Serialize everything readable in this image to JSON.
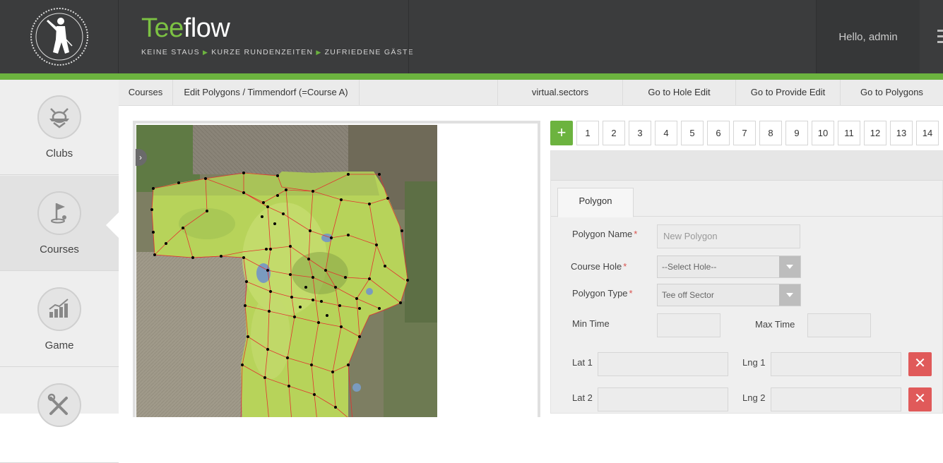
{
  "header": {
    "brand_tee": "Tee",
    "brand_flow": "flow",
    "tagline": [
      "KEINE STAUS",
      "KURZE RUNDENZEITEN",
      "ZUFRIEDENE GÄSTE"
    ],
    "greeting": "Hello, admin",
    "logo_icon": "golfer-logo-icon",
    "menu_icon": "menu-icon"
  },
  "sidebar": {
    "items": [
      {
        "label": "Clubs",
        "icon": "club-crest-icon"
      },
      {
        "label": "Courses",
        "icon": "golf-flag-icon",
        "active": true
      },
      {
        "label": "Game",
        "icon": "bar-chart-icon"
      },
      {
        "label": "",
        "icon": "tools-icon"
      }
    ]
  },
  "subnav": {
    "courses": "Courses",
    "edit_polygons": "Edit Polygons / Timmendorf (=Course A)",
    "virtual_sectors": "virtual.sectors",
    "go_hole_edit": "Go to Hole Edit",
    "go_provide_edit": "Go to Provide Edit",
    "go_polygons": "Go to Polygons"
  },
  "holes": {
    "add_label": "+",
    "numbers": [
      "1",
      "2",
      "3",
      "4",
      "5",
      "6",
      "7",
      "8",
      "9",
      "10",
      "11",
      "12",
      "13",
      "14"
    ]
  },
  "form": {
    "tab_label": "Polygon",
    "polygon_name_label": "Polygon Name",
    "polygon_name_placeholder": "New Polygon",
    "course_hole_label": "Course Hole",
    "course_hole_value": "--Select Hole--",
    "polygon_type_label": "Polygon Type",
    "polygon_type_value": "Tee off Sector",
    "required_mark": "*",
    "min_time_label": "Min Time",
    "max_time_label": "Max Time",
    "lat1_label": "Lat 1",
    "lng1_label": "Lng 1",
    "lat2_label": "Lat 2",
    "lng2_label": "Lng 2",
    "delete_symbol": "✕"
  },
  "colors": {
    "accent_green": "#6cb33f",
    "header_dark": "#3b3c3d",
    "delete_red": "#e05a5a"
  }
}
